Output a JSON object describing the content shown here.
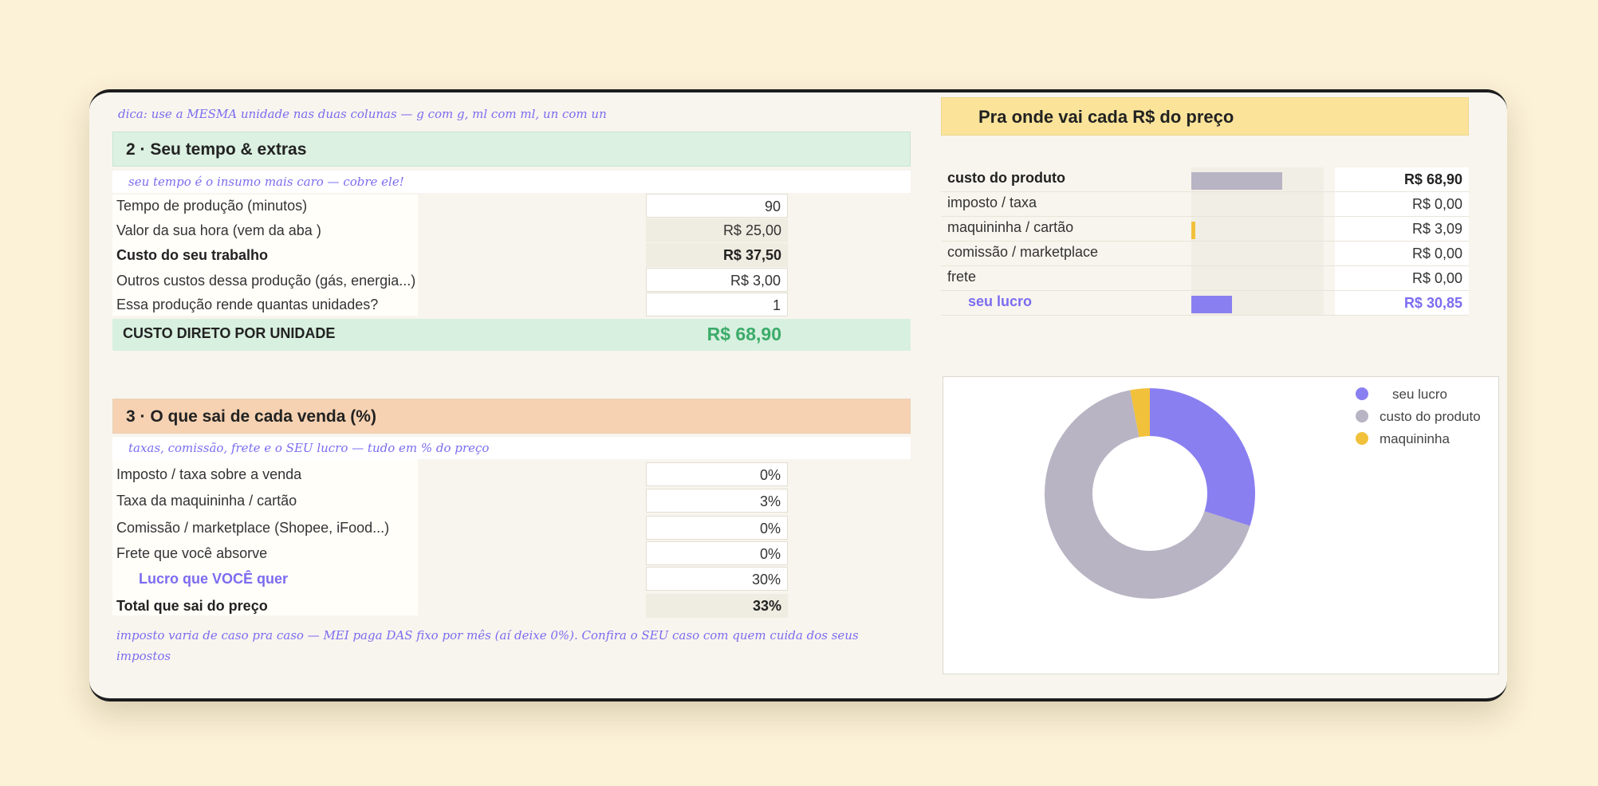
{
  "tip": "dica: use a MESMA unidade nas duas colunas — g com g, ml com ml, un com un",
  "section2": {
    "title": "2 · Seu tempo & extras",
    "subtitle": "seu tempo é o insumo mais caro — cobre ele!",
    "rows": [
      {
        "label": "Tempo de produção (minutos)",
        "value": "90"
      },
      {
        "label": "Valor da sua hora (vem da aba      )",
        "value": "R$ 25,00"
      },
      {
        "label": "Custo do seu trabalho",
        "value": "R$ 37,50"
      },
      {
        "label": "Outros custos dessa produção (gás, energia...)",
        "value": "R$ 3,00"
      },
      {
        "label": "Essa produção rende quantas unidades?",
        "value": "1"
      }
    ],
    "total_label": "CUSTO DIRETO POR UNIDADE",
    "total_value": "R$ 68,90"
  },
  "section3": {
    "title": "3 · O que sai de cada venda (%)",
    "subtitle": "taxas, comissão, frete e o SEU lucro — tudo em % do preço",
    "rows": [
      {
        "label": "Imposto / taxa sobre a venda",
        "value": "0%"
      },
      {
        "label": "Taxa da maquininha / cartão",
        "value": "3%"
      },
      {
        "label": "Comissão / marketplace (Shopee, iFood...)",
        "value": "0%"
      },
      {
        "label": "Frete que você absorve",
        "value": "0%"
      },
      {
        "label": "Lucro que VOCÊ quer",
        "value": "30%"
      },
      {
        "label": "Total que sai do preço",
        "value": "33%"
      }
    ],
    "note": "imposto varia de caso pra caso — MEI paga DAS fixo por mês (aí deixe 0%). Confira o SEU caso com quem cuida dos seus impostos"
  },
  "breakdown": {
    "title": "Pra onde vai cada R$ do preço",
    "rows": [
      {
        "label": "custo do produto",
        "value": "R$ 68,90",
        "fraction": 0.541
      },
      {
        "label": "imposto / taxa",
        "value": "R$ 0,00",
        "fraction": 0
      },
      {
        "label": "maquininha / cartão",
        "value": "R$ 3,09",
        "fraction": 0.024
      },
      {
        "label": "comissão / marketplace",
        "value": "R$ 0,00",
        "fraction": 0
      },
      {
        "label": "frete",
        "value": "R$ 0,00",
        "fraction": 0
      },
      {
        "label": "seu lucro",
        "value": "R$ 30,85",
        "fraction": 0.242
      }
    ]
  },
  "colors": {
    "produto": "#b8b4c4",
    "maquininha": "#f1c13c",
    "lucro": "#8a7ff0"
  },
  "chart_data": {
    "type": "pie",
    "categories": [
      "seu lucro",
      "custo do produto",
      "maquininha"
    ],
    "values": [
      30.85,
      68.9,
      3.09
    ],
    "colors": [
      "#8a7ff0",
      "#b8b4c4",
      "#f1c13c"
    ],
    "legend": "right"
  }
}
